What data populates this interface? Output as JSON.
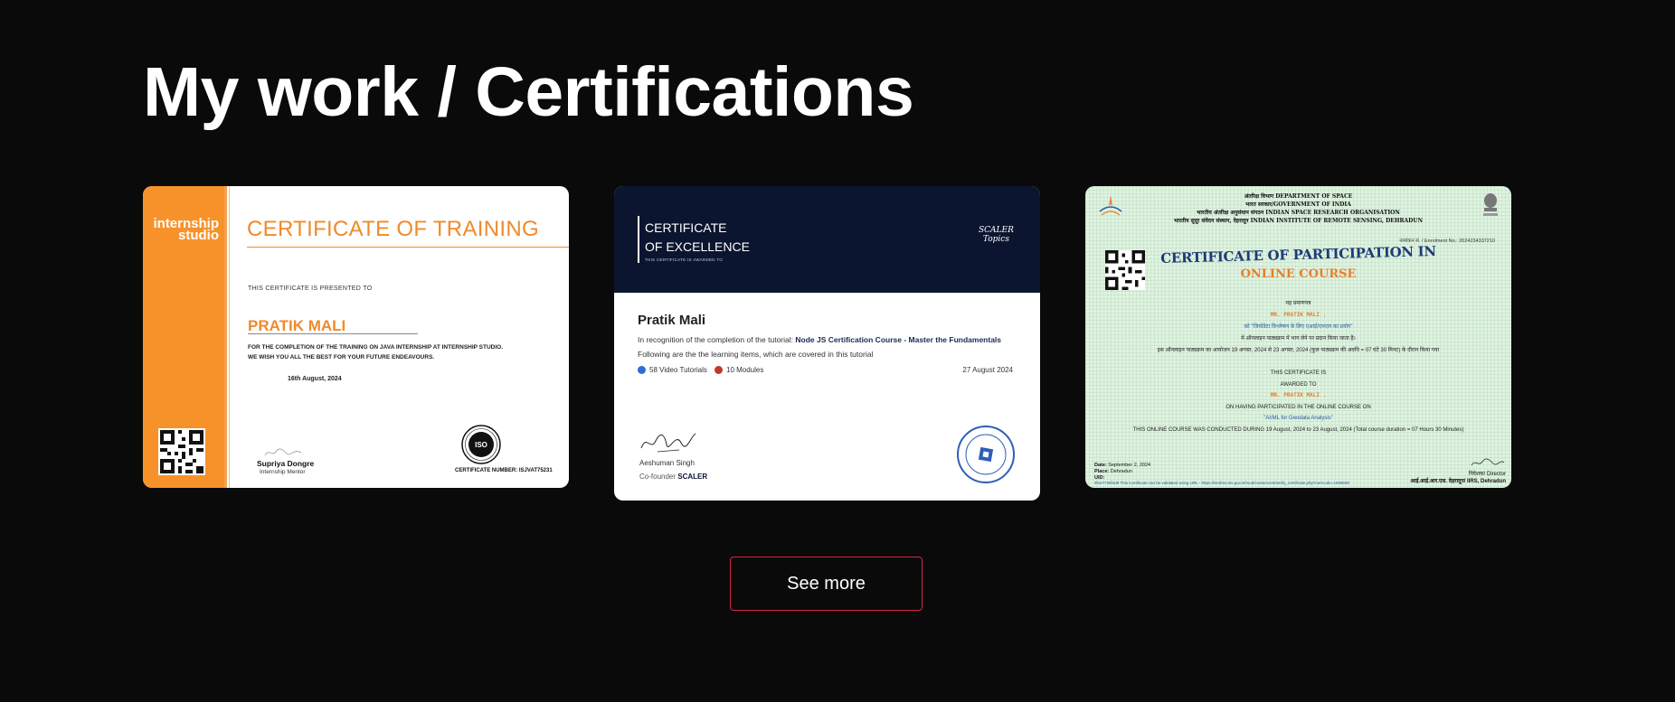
{
  "section": {
    "title": "My work / Certifications"
  },
  "certificates": [
    {
      "logo": "internship studio",
      "title": "CERTIFICATE OF TRAINING",
      "presented": "THIS CERTIFICATE IS PRESENTED TO",
      "name": "PRATIK MALI",
      "body_line1": "FOR THE COMPLETION OF THE TRAINING ON JAVA INTERNSHIP AT INTERNSHIP STUDIO.",
      "body_line2": "WE WISH YOU ALL THE BEST FOR YOUR FUTURE ENDEAVOURS.",
      "date": "16th August, 2024",
      "signer": "Supriya Dongre",
      "signer_role": "Internship Mentor",
      "certificate_number": "CERTIFICATE NUMBER:  ISJVAT75231",
      "accent": "#f7922b"
    },
    {
      "title_line1": "CERTIFICATE",
      "title_line2": "OF EXCELLENCE",
      "awarded": "THIS CERTIFICATE IS AWARDED TO",
      "logo_line1": "SCALER",
      "logo_line2": "Topics",
      "name": "Pratik Mali",
      "text_prefix": "In recognition of the completion of the tutorial: ",
      "course": "Node JS Certification Course - Master the Fundamentals",
      "text2": "Following are the the learning items, which are covered in this tutorial",
      "item1": "58 Video Tutorials",
      "item2": "10 Modules",
      "date": "27 August 2024",
      "signer": "Aeshuman Singh",
      "signer_role_prefix": "Co-founder ",
      "signer_company": "SCALER",
      "accent": "#0c1530"
    },
    {
      "header_line1": "अंतरिक्ष विभाग DEPARTMENT OF SPACE",
      "header_line2": "भारत सरकार/GOVERNMENT OF INDIA",
      "header_line3": "भारतीय अंतरिक्ष अनुसंधान संगठन INDIAN SPACE RESEARCH ORGANISATION",
      "header_line4": "भारतीय सुदूर संवेदन संस्थान, देहरादून INDIAN INSTITUTE OF REMOTE SENSING, DEHRADUN",
      "enrolment": "नामांकन सं. / Enrolment No.: 2024234337210",
      "title": "CERTIFICATE OF PARTICIPATION IN",
      "subtitle": "ONLINE COURSE",
      "hindi_line1": "यह प्रमाणपत्र",
      "name_hindi": "MR. PRATIK MALI .",
      "hindi_course": "को \"जियोडेटा विश्लेषण के लिए एआई/एमएल का प्रयोग\"",
      "hindi_line3": "में ऑनलाइन पाठ्यक्रम में भाग लेने पर प्रदान किया जाता है।",
      "hindi_line4": "इस ऑनलाइन पाठ्यक्रम का आयोजन 19 अगस्त, 2024 से 23 अगस्त, 2024 (कुल पाठ्यक्रम की अवधि = 07 घंटे 30 मिनट) के दौरान किया गया",
      "eng_line1": "THIS CERTIFICATE IS",
      "eng_line2": "AWARDED TO",
      "name": "MR. PRATIK MALI .",
      "eng_line3": "ON HAVING PARTICIPATED IN THE ONLINE COURSE ON",
      "course": "\"AI/ML for Geodata Analysis\"",
      "eng_line4": "THIS ONLINE COURSE WAS CONDUCTED DURING 19 August, 2024 to 23 August, 2024 (Total course duration = 07 Hours 30 Minutes)",
      "date_label": "Date: ",
      "date": "September 2, 2024",
      "place_label": "Place: ",
      "place": "Dehradun",
      "uid_label": "UID:",
      "director": "निदेशक/ Director",
      "director_org": "आई.आई.आर.एस. देहरादून/ IIRS, Dehradun",
      "verify": "  9fce7738f4d9    This Certificate can be validated using URL - https://isrolms.iirs.gov.in/mod/customcert/verify_certificate.php?certcode=1069608"
    }
  ],
  "actions": {
    "see_more": "See more"
  },
  "colors": {
    "background": "#0a0a0a",
    "button_border": "#d6254a"
  }
}
